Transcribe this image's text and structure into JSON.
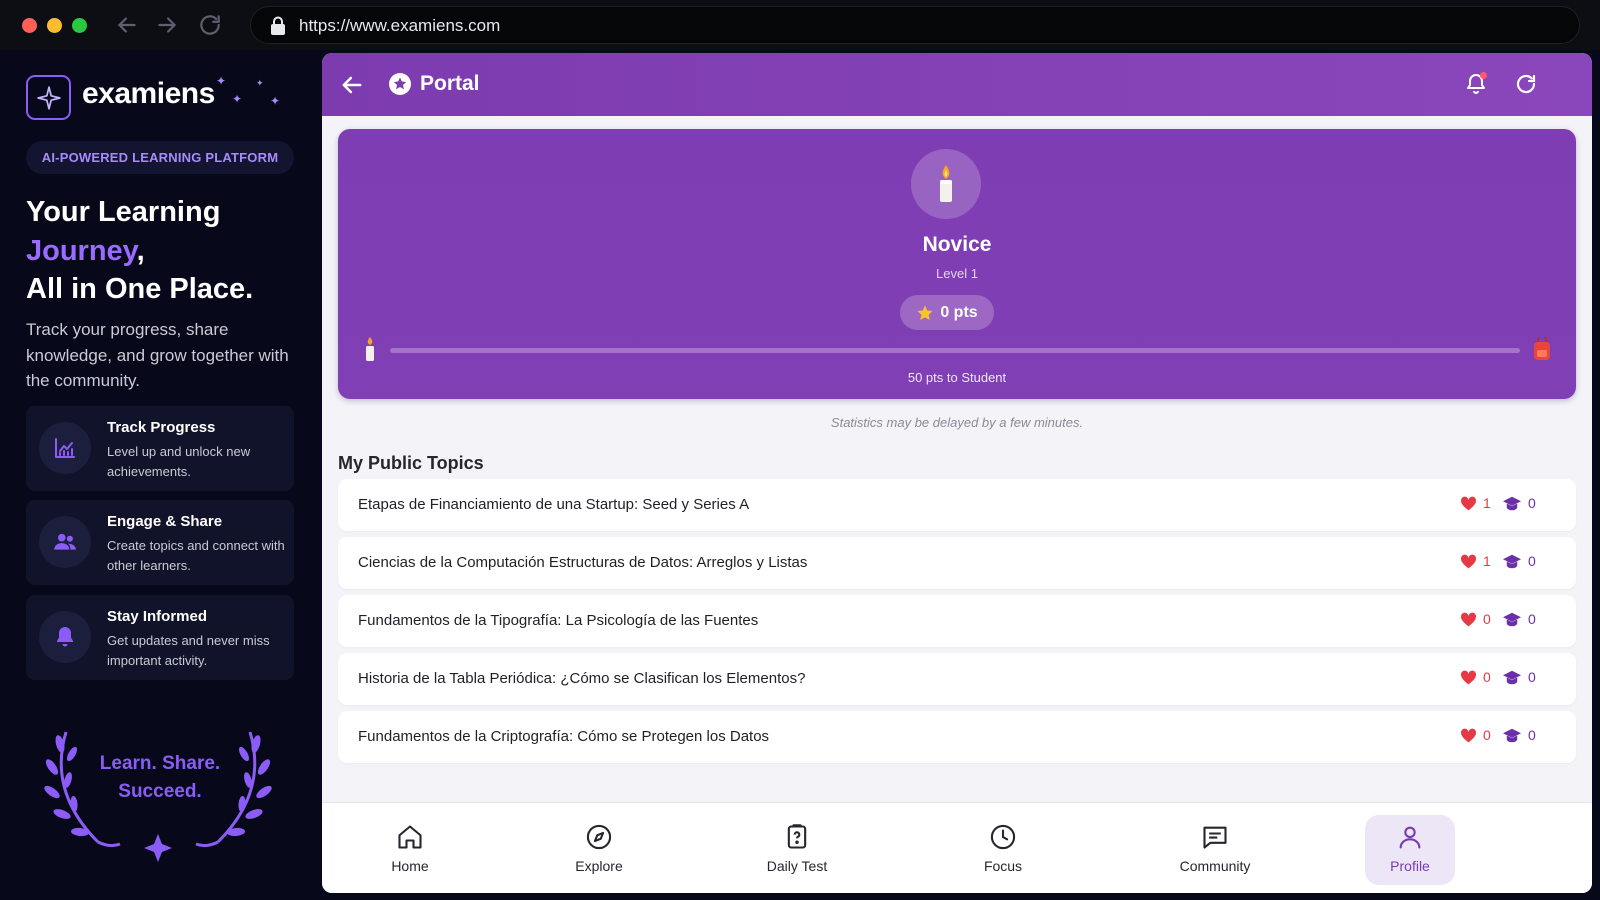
{
  "browser": {
    "url": "https://www.examiens.com"
  },
  "sidebar": {
    "brand": "examiens",
    "tagline": "AI-POWERED LEARNING PLATFORM",
    "headline_line1": "Your Learning",
    "headline_accent": "Journey",
    "headline_comma": ",",
    "headline_line3": "All in One Place.",
    "description": "Track your progress, share knowledge, and grow together with the community.",
    "features": [
      {
        "title": "Track Progress",
        "desc": "Level up and unlock new achievements.",
        "icon": "chart-icon"
      },
      {
        "title": "Engage & Share",
        "desc": "Create topics and connect with other learners.",
        "icon": "users-icon"
      },
      {
        "title": "Stay Informed",
        "desc": "Get updates and never miss important activity.",
        "icon": "bell-icon"
      }
    ],
    "motto_line1": "Learn. Share.",
    "motto_line2": "Succeed."
  },
  "appbar": {
    "title": "Portal"
  },
  "level": {
    "name": "Novice",
    "level_label": "Level 1",
    "points": "0 pts",
    "progress_fraction": 0,
    "next_level_text": "50 pts to Student"
  },
  "stats_note": "Statistics may be delayed by a few minutes.",
  "topics_section": {
    "title": "My Public Topics",
    "items": [
      {
        "title": "Etapas de Financiamiento de una Startup: Seed y Series A",
        "likes": "1",
        "learners": "0"
      },
      {
        "title": "Ciencias de la Computación Estructuras de Datos: Arreglos y Listas",
        "likes": "1",
        "learners": "0"
      },
      {
        "title": "Fundamentos de la Tipografía: La Psicología de las Fuentes",
        "likes": "0",
        "learners": "0"
      },
      {
        "title": "Historia de la Tabla Periódica: ¿Cómo se Clasifican los Elementos?",
        "likes": "0",
        "learners": "0"
      },
      {
        "title": "Fundamentos de la Criptografía: Cómo se Protegen los Datos",
        "likes": "0",
        "learners": "0"
      }
    ]
  },
  "bottom_nav": {
    "items": [
      {
        "label": "Home",
        "icon": "home-icon"
      },
      {
        "label": "Explore",
        "icon": "compass-icon"
      },
      {
        "label": "Daily Test",
        "icon": "quiz-icon"
      },
      {
        "label": "Focus",
        "icon": "clock-icon"
      },
      {
        "label": "Community",
        "icon": "chat-icon"
      },
      {
        "label": "Profile",
        "icon": "user-icon"
      }
    ],
    "active": "Profile"
  },
  "colors": {
    "accent": "#8b5cf6",
    "appbar": "#7d3bb0",
    "like": "#e53945",
    "learners": "#6b2fa8"
  }
}
